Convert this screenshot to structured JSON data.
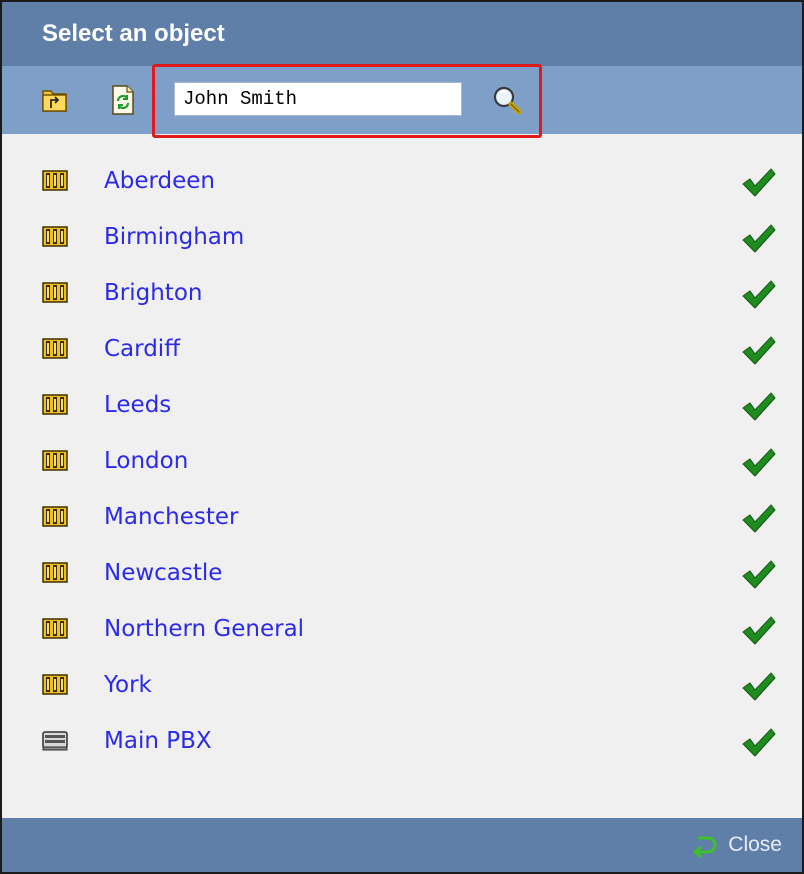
{
  "dialog": {
    "title": "Select an object"
  },
  "toolbar": {
    "folder_up_icon": "folder-up-icon",
    "refresh_icon": "refresh-icon",
    "search": {
      "value": "John Smith",
      "placeholder": ""
    },
    "search_icon": "magnifier-icon"
  },
  "objects": [
    {
      "label": "Aberdeen",
      "icon": "site-icon",
      "status": "check-icon"
    },
    {
      "label": "Birmingham",
      "icon": "site-icon",
      "status": "check-icon"
    },
    {
      "label": "Brighton",
      "icon": "site-icon",
      "status": "check-icon"
    },
    {
      "label": "Cardiff",
      "icon": "site-icon",
      "status": "check-icon"
    },
    {
      "label": "Leeds",
      "icon": "site-icon",
      "status": "check-icon"
    },
    {
      "label": "London",
      "icon": "site-icon",
      "status": "check-icon"
    },
    {
      "label": "Manchester",
      "icon": "site-icon",
      "status": "check-icon"
    },
    {
      "label": "Newcastle",
      "icon": "site-icon",
      "status": "check-icon"
    },
    {
      "label": "Northern General",
      "icon": "site-icon",
      "status": "check-icon"
    },
    {
      "label": "York",
      "icon": "site-icon",
      "status": "check-icon"
    },
    {
      "label": "Main PBX",
      "icon": "pbx-icon",
      "status": "check-icon"
    }
  ],
  "footer": {
    "close_label": "Close"
  },
  "colors": {
    "titlebar": "#5f7fa8",
    "toolbar": "#7e9fc8",
    "highlight_border": "#e01a1a",
    "link": "#2a2ae8",
    "check": "#1f8a1f"
  }
}
